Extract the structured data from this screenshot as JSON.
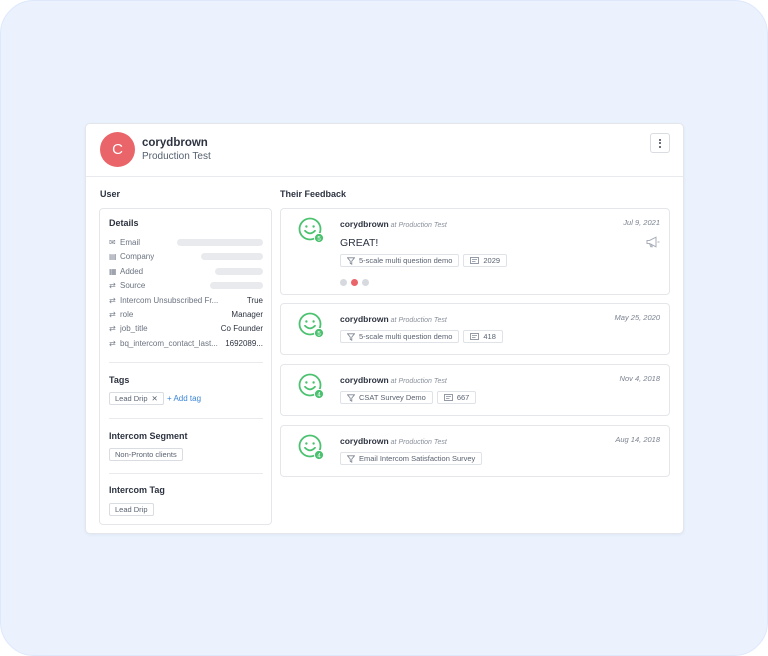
{
  "profile": {
    "avatar_letter": "C",
    "name": "corydbrown",
    "subtitle": "Production Test"
  },
  "left": {
    "section_title": "User",
    "details": {
      "heading": "Details",
      "rows": [
        {
          "icon": "email-icon",
          "label": "Email",
          "value": ""
        },
        {
          "icon": "company-icon",
          "label": "Company",
          "value": ""
        },
        {
          "icon": "calendar-icon",
          "label": "Added",
          "value": ""
        },
        {
          "icon": "sync-icon",
          "label": "Source",
          "value": ""
        },
        {
          "icon": "sync-icon",
          "label": "Intercom Unsubscribed Fr...",
          "value": "True"
        },
        {
          "icon": "sync-icon",
          "label": "role",
          "value": "Manager"
        },
        {
          "icon": "sync-icon",
          "label": "job_title",
          "value": "Co Founder"
        },
        {
          "icon": "sync-icon",
          "label": "bq_intercom_contact_last...",
          "value": "1692089..."
        }
      ]
    },
    "tags": {
      "heading": "Tags",
      "items": [
        "Lead Drip"
      ],
      "add_label": "Add tag"
    },
    "segment": {
      "heading": "Intercom Segment",
      "items": [
        "Non-Pronto clients"
      ]
    },
    "intercom_tag": {
      "heading": "Intercom Tag",
      "items": [
        "Lead Drip"
      ]
    }
  },
  "feedback": {
    "section_title": "Their Feedback",
    "items": [
      {
        "name": "corydbrown",
        "at": "at Production Test",
        "date": "Jul 9, 2021",
        "text": "GREAT!",
        "score": "5",
        "survey": "5-scale multi question demo",
        "id": "2029"
      },
      {
        "name": "corydbrown",
        "at": "at Production Test",
        "date": "May 25, 2020",
        "text": "",
        "score": "5",
        "survey": "5-scale multi question demo",
        "id": "418"
      },
      {
        "name": "corydbrown",
        "at": "at Production Test",
        "date": "Nov 4, 2018",
        "text": "",
        "score": "4",
        "survey": "CSAT Survey Demo",
        "id": "667"
      },
      {
        "name": "corydbrown",
        "at": "at Production Test",
        "date": "Aug 14, 2018",
        "text": "",
        "score": "4",
        "survey": "Email Intercom Satisfaction Survey",
        "id": ""
      }
    ]
  },
  "colors": {
    "avatar": "#e9656a",
    "smiley": "#4cc270",
    "link": "#3a86d8",
    "background": "#ebf2fe"
  }
}
